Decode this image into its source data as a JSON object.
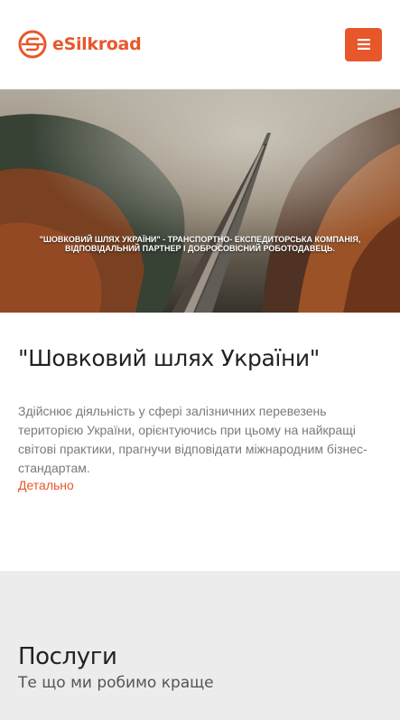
{
  "header": {
    "brand": "eSilkroad",
    "menu_icon": "hamburger-icon",
    "accent_color": "#e8572a"
  },
  "hero": {
    "caption_line1": "\"Шовковий шлях України\" - транспортно- експедиторська компанія,",
    "caption_line2": "відповідальний партнер і добросовісний роботодавець."
  },
  "about": {
    "title": "\"Шовковий шлях України\"",
    "text": "Здійснює діяльність у сфері залізничних перевезень територією України, орієнтуючись при цьому на найкращі світові практики, прагнучи відповідати міжнародним бізнес-стандартам.",
    "more_link": "Детально"
  },
  "services": {
    "title": "Послуги",
    "subtitle": "Те що ми робимо краще"
  }
}
